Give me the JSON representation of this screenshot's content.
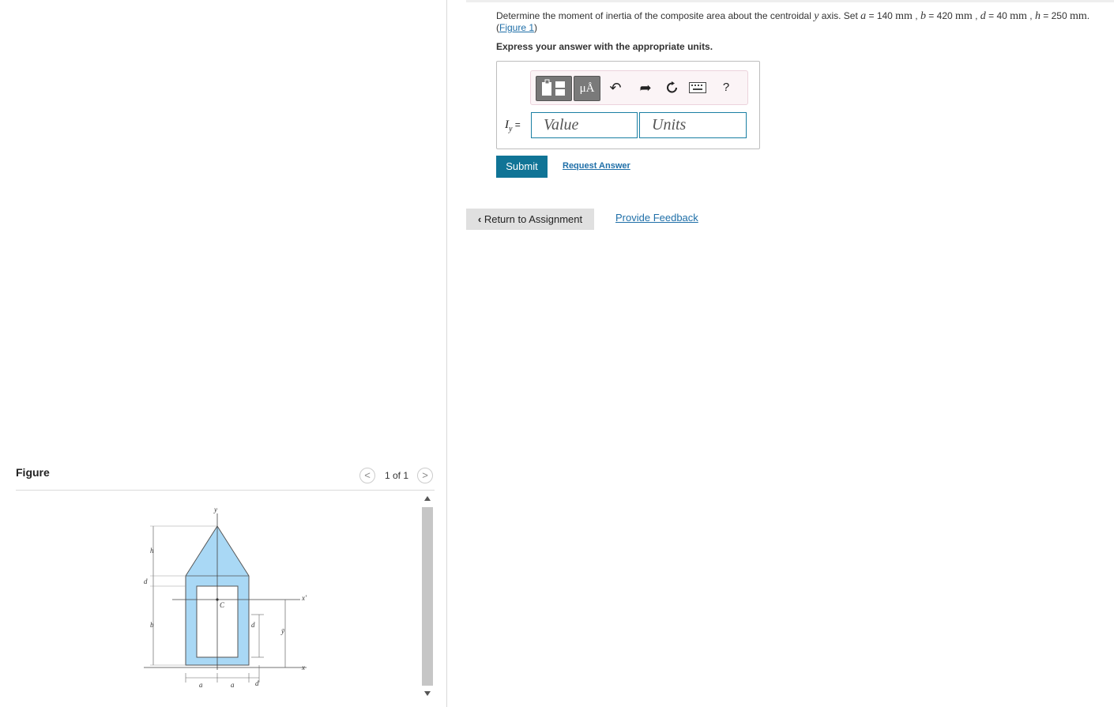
{
  "question": {
    "prefix": "Determine the moment of inertia of the composite area about the centroidal ",
    "axis_var": "y",
    "axis_word": " axis. Set ",
    "a_var": "a",
    "a_val": " = 140 ",
    "a_unit": "mm",
    "sep1": " , ",
    "b_var": "b",
    "b_val": " = 420 ",
    "b_unit": "mm",
    "sep2": " , ",
    "d_var": "d",
    "d_val": " = 40 ",
    "d_unit": "mm",
    "sep3": " , ",
    "h_var": "h",
    "h_val": " = 250 ",
    "h_unit": "mm",
    "end": ".",
    "figure_link": "Figure 1",
    "open_paren": "(",
    "close_paren": ")"
  },
  "express": "Express your answer with the appropriate units.",
  "toolbar": {
    "mu_label": "μÅ",
    "help_label": "?"
  },
  "answer": {
    "label_var": "I",
    "label_sub": "y",
    "label_eq": " =",
    "value_placeholder": "Value",
    "units_placeholder": "Units"
  },
  "actions": {
    "submit": "Submit",
    "request": "Request Answer",
    "return": "Return to Assignment",
    "feedback": "Provide Feedback"
  },
  "figure_panel": {
    "title": "Figure",
    "pager": "1 of 1",
    "prev": "<",
    "next": ">"
  },
  "figure_labels": {
    "y": "y",
    "h": "h",
    "d": "d",
    "b": "b",
    "c": "C",
    "x_prime": "x′",
    "x": "x",
    "y_bar": "ȳ",
    "a": "a"
  },
  "colors": {
    "accent": "#107496",
    "link": "#1f6fa8",
    "shape_fill": "#a9d8f5"
  }
}
